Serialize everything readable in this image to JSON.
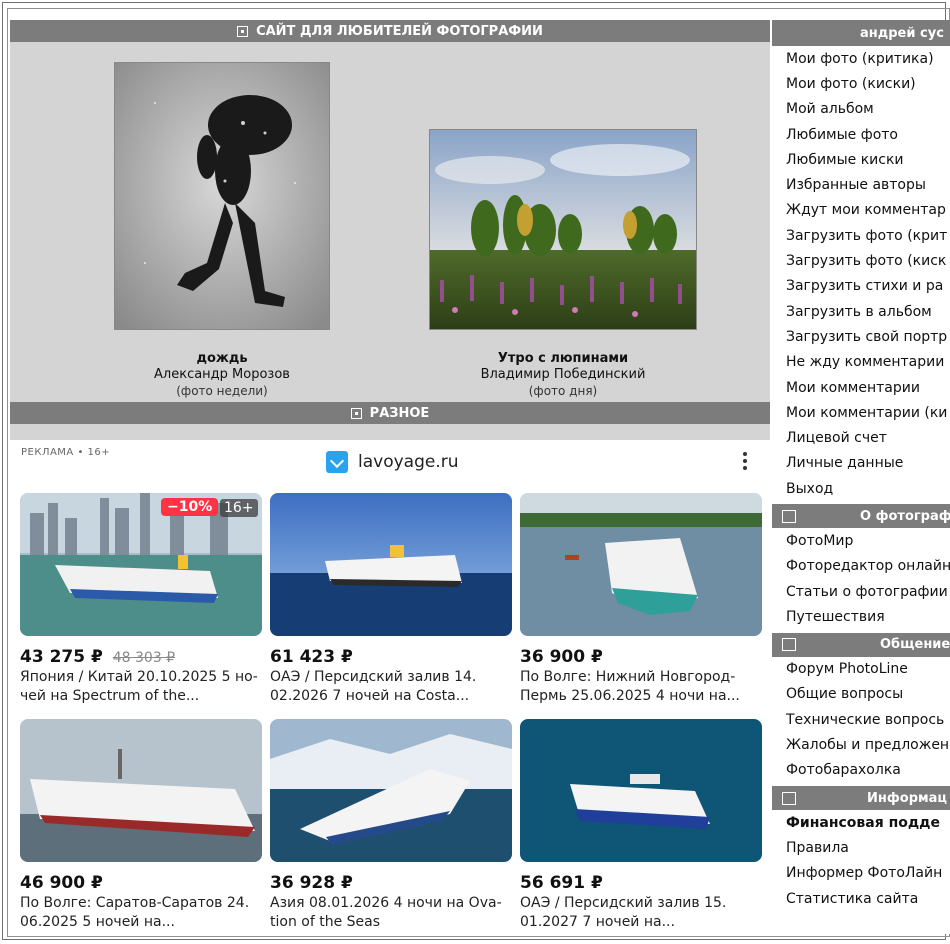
{
  "header": {
    "title": "САЙТ ДЛЯ ЛЮБИТЕЛЕЙ ФОТОГРАФИИ"
  },
  "featured": [
    {
      "title": "дождь",
      "author": "Александр Морозов",
      "note": "(фото недели)"
    },
    {
      "title": "Утро с люпинами",
      "author": "Владимир Побединский",
      "note": "(фото дня)"
    }
  ],
  "misc_bar": {
    "title": "РАЗНОЕ"
  },
  "ad": {
    "label": "РЕКЛАМА • 16+",
    "domain": "lavoyage.ru",
    "cards": [
      {
        "price": "43 275 ₽",
        "old_price": "48 303 ₽",
        "badge": "−10%",
        "age": "16+",
        "desc": "Япония / Китай 20.10.2025 5 но-чей на Spectrum of the..."
      },
      {
        "price": "61 423 ₽",
        "desc": "ОАЭ / Персидский залив 14. 02.2026 7 ночей на Costa..."
      },
      {
        "price": "36 900 ₽",
        "desc": "По Волге: Нижний Новгород-Пермь 25.06.2025 4 ночи на..."
      },
      {
        "price": "46 900 ₽",
        "desc": "По Волге: Саратов-Саратов 24. 06.2025 5 ночей на..."
      },
      {
        "price": "36 928 ₽",
        "desc": "Азия 08.01.2026 4 ночи на Ova-tion of the Seas"
      },
      {
        "price": "56 691 ₽",
        "desc": "ОАЭ / Персидский залив 15. 01.2027 7 ночей на..."
      }
    ]
  },
  "sidebar": {
    "user": "андрей сус",
    "user_items": [
      "Мои фото (критика)",
      "Мои фото (киски)",
      "Мой альбом",
      "Любимые фото",
      "Любимые киски",
      "Избранные авторы",
      "Ждут мои комментар",
      "Загрузить фото (крит",
      "Загрузить фото (киск",
      "Загрузить стихи и ра",
      "Загрузить в альбом",
      "Загрузить свой портр",
      "Не жду комментарии",
      "Мои комментарии",
      "Мои комментарии (ки",
      "Лицевой счет",
      "Личные данные",
      "Выход"
    ],
    "photo_section": "О фотограф",
    "photo_items": [
      "ФотоМир",
      "Фоторедактор онлайн",
      "Статьи о фотографии",
      "Путешествия"
    ],
    "talk_section": "Общение",
    "talk_items": [
      "Форум PhotoLine",
      "Общие вопросы",
      "Технические вопрось",
      "Жалобы и предложен",
      "Фотобарахолка"
    ],
    "info_section": "Информац",
    "info_items": [
      "Финансовая подде",
      "Правила",
      "Информер ФотоЛайн",
      "Статистика сайта"
    ]
  }
}
